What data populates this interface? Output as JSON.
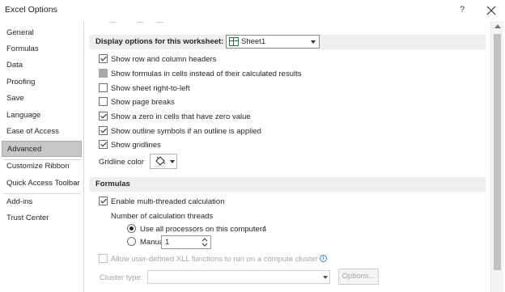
{
  "window": {
    "title": "Excel Options",
    "help_label": "?"
  },
  "sidebar": {
    "items": [
      {
        "label": "General"
      },
      {
        "label": "Formulas"
      },
      {
        "label": "Data"
      },
      {
        "label": "Proofing"
      },
      {
        "label": "Save"
      },
      {
        "label": "Language"
      },
      {
        "label": "Ease of Access"
      },
      {
        "label": "Advanced"
      },
      {
        "label": "Customize Ribbon"
      },
      {
        "label": "Quick Access Toolbar"
      },
      {
        "label": "Add-ins"
      },
      {
        "label": "Trust Center"
      }
    ],
    "selected": "Advanced"
  },
  "worksheet": {
    "header": "Display options for this worksheet:",
    "sheet_value": "Sheet1",
    "options": [
      {
        "label": "Show row and column headers",
        "checked": true
      },
      {
        "label": "Show formulas in cells instead of their calculated results",
        "checked": "indeterminate"
      },
      {
        "label": "Show sheet right-to-left",
        "checked": false
      },
      {
        "label": "Show page breaks",
        "checked": false
      },
      {
        "label": "Show a zero in cells that have zero value",
        "checked": true
      },
      {
        "label": "Show outline symbols if an outline is applied",
        "checked": true
      },
      {
        "label": "Show gridlines",
        "checked": true
      }
    ],
    "gridline_color_label": "Gridline color"
  },
  "formulas": {
    "header": "Formulas",
    "multithreaded_label": "Enable multi-threaded calculation",
    "multithreaded_checked": true,
    "threads_label": "Number of calculation threads",
    "use_all_label": "Use all processors on this computer:",
    "processor_count": "4",
    "manual_label": "Manual",
    "manual_value": "1",
    "xll_label": "Allow user-defined XLL functions to run on a compute cluster",
    "cluster_type_label": "Cluster type:",
    "options_button": "Options..."
  },
  "colors": {
    "accent_green": "#217346",
    "selected_bg": "#c6c6c6",
    "section_bg": "#efefef",
    "disabled_text": "#a6a6a6"
  }
}
